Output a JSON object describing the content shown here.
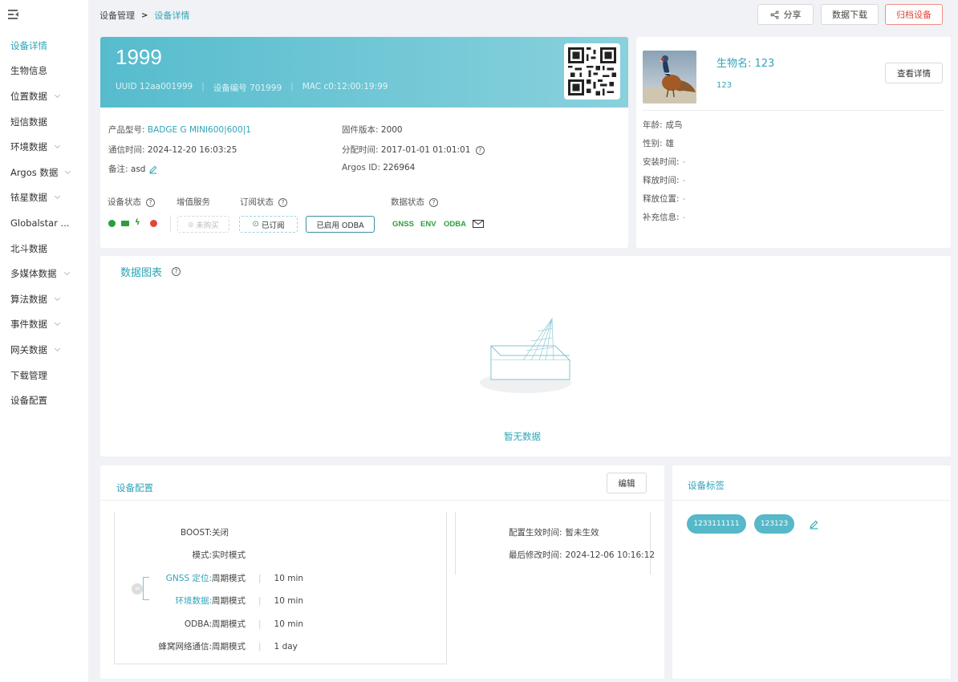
{
  "sidebar": {
    "items": [
      {
        "label": "设备详情",
        "active": true,
        "chevron": false
      },
      {
        "label": "生物信息",
        "active": false,
        "chevron": false
      },
      {
        "label": "位置数据",
        "active": false,
        "chevron": true
      },
      {
        "label": "短信数据",
        "active": false,
        "chevron": false
      },
      {
        "label": "环境数据",
        "active": false,
        "chevron": true
      },
      {
        "label": "Argos 数据",
        "active": false,
        "chevron": true
      },
      {
        "label": "铱星数据",
        "active": false,
        "chevron": true
      },
      {
        "label": "Globalstar ...",
        "active": false,
        "chevron": false
      },
      {
        "label": "北斗数据",
        "active": false,
        "chevron": false
      },
      {
        "label": "多媒体数据",
        "active": false,
        "chevron": true
      },
      {
        "label": "算法数据",
        "active": false,
        "chevron": true
      },
      {
        "label": "事件数据",
        "active": false,
        "chevron": true
      },
      {
        "label": "网关数据",
        "active": false,
        "chevron": true
      },
      {
        "label": "下载管理",
        "active": false,
        "chevron": false
      },
      {
        "label": "设备配置",
        "active": false,
        "chevron": false
      }
    ]
  },
  "breadcrumb": {
    "parent": "设备管理",
    "separator": ">",
    "current": "设备详情"
  },
  "toolbar": {
    "share": "分享",
    "download": "数据下载",
    "return": "归档设备"
  },
  "device": {
    "name": "1999",
    "uuid": "UUID 12aa001999",
    "device_no": "设备编号 701999",
    "mac": "MAC c0:12:00:19:99",
    "product_label": "产品型号:",
    "product_value": "BADGE G MINI600|600|1",
    "comm_label": "通信时间:",
    "comm_value": "2024-12-20 16:03:25",
    "note_label": "备注:",
    "note_value": "asd",
    "firmware_label": "固件版本:",
    "firmware_value": "2000",
    "assign_label": "分配时间:",
    "assign_value": "2017-01-01 01:01:01",
    "argos_label": "Argos ID:",
    "argos_value": "226964"
  },
  "status": {
    "device_status": "设备状态",
    "service": "增值服务",
    "subscription": "订阅状态",
    "data_status": "数据状态",
    "unpurchased": "未购买",
    "subscribed": "已订阅",
    "odba_enabled": "已启用 ODBA",
    "data_tags": [
      "GNSS",
      "ENV",
      "ODBA"
    ],
    "colors": {
      "green": "#2a9e3c",
      "red": "#e0473a",
      "accent": "#2fa4b8"
    }
  },
  "animal": {
    "name": "生物名: 123",
    "sub": "123",
    "view_details": "查看详情",
    "attrs": [
      {
        "label": "年龄:",
        "value": "成鸟"
      },
      {
        "label": "性别:",
        "value": "雄"
      },
      {
        "label": "安装时间:",
        "value": "-"
      },
      {
        "label": "释放时间:",
        "value": "-"
      },
      {
        "label": "释放位置:",
        "value": "-"
      },
      {
        "label": "补充信息:",
        "value": "-"
      }
    ]
  },
  "chart": {
    "title": "数据图表",
    "empty": "暂无数据"
  },
  "config": {
    "title": "设备配置",
    "edit": "编辑",
    "rows": [
      {
        "label": "BOOST:",
        "value": "关闭",
        "extra": "",
        "link": false
      },
      {
        "label": "模式:",
        "value": "实时模式",
        "extra": "",
        "link": false
      },
      {
        "label": "GNSS 定位:",
        "value": "周期模式",
        "extra": "10 min",
        "link": true
      },
      {
        "label": "环境数据:",
        "value": "周期模式",
        "extra": "10 min",
        "link": true
      },
      {
        "label": "ODBA:",
        "value": "周期模式",
        "extra": "10 min",
        "link": false
      },
      {
        "label": "蜂窝网络通信:",
        "value": "周期模式",
        "extra": "1 day",
        "link": false
      }
    ],
    "effect_label": "配置生效时间:",
    "effect_value": "暂未生效",
    "modified_label": "最后修改时间:",
    "modified_value": "2024-12-06 10:16:12"
  },
  "tags": {
    "title": "设备标签",
    "items": [
      "1233111111",
      "123123"
    ]
  }
}
